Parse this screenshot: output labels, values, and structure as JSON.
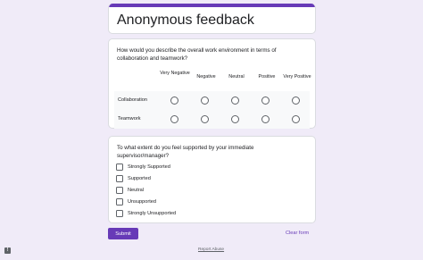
{
  "form": {
    "title": "Anonymous feedback",
    "accent_color": "#673ab7",
    "background_color": "#f0ebf8"
  },
  "question1": {
    "text": "How would you describe the overall work environment in terms of collaboration and teamwork?",
    "columns": [
      "Very Negative",
      "Negative",
      "Neutral",
      "Positive",
      "Very Positive"
    ],
    "rows": [
      "Collaboration",
      "Teamwork"
    ]
  },
  "question2": {
    "text": "To what extent do you feel supported by your immediate supervisor/manager?",
    "options": [
      "Strongly Supported",
      "Supported",
      "Neutral",
      "Unsupported",
      "Strongly Unsupported"
    ]
  },
  "footer": {
    "submit_label": "Submit",
    "clear_label": "Clear form",
    "report_label": "Report Abuse",
    "feedback_icon": "feedback-icon",
    "feedback_glyph": "!"
  }
}
